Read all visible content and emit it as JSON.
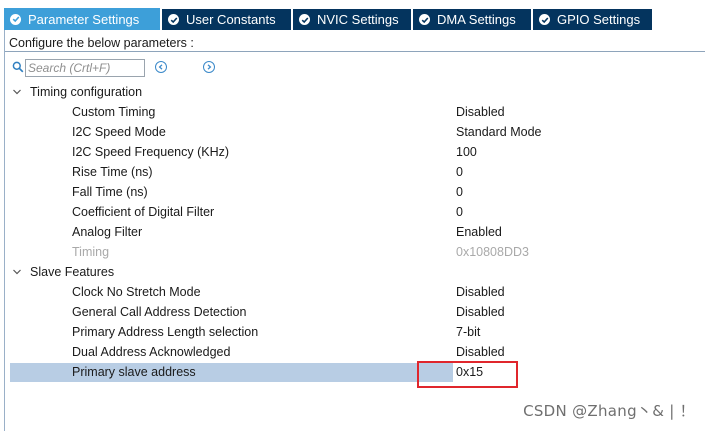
{
  "tabs": [
    {
      "label": "Parameter Settings",
      "active": true,
      "icon": "check-circle-icon"
    },
    {
      "label": "User Constants",
      "active": false,
      "icon": "check-circle-icon"
    },
    {
      "label": "NVIC Settings",
      "active": false,
      "icon": "check-circle-icon"
    },
    {
      "label": "DMA Settings",
      "active": false,
      "icon": "check-circle-icon"
    },
    {
      "label": "GPIO Settings",
      "active": false,
      "icon": "check-circle-icon"
    }
  ],
  "configure_label": "Configure the below parameters :",
  "search": {
    "placeholder": "Search (Crtl+F)",
    "value": ""
  },
  "groups": [
    {
      "title": "Timing configuration",
      "expanded": true,
      "params": [
        {
          "label": "Custom Timing",
          "value": "Disabled"
        },
        {
          "label": "I2C Speed Mode",
          "value": "Standard Mode"
        },
        {
          "label": "I2C Speed Frequency (KHz)",
          "value": "100"
        },
        {
          "label": "Rise Time (ns)",
          "value": "0"
        },
        {
          "label": "Fall Time (ns)",
          "value": "0"
        },
        {
          "label": "Coefficient of Digital Filter",
          "value": "0"
        },
        {
          "label": "Analog Filter",
          "value": "Enabled"
        },
        {
          "label": "Timing",
          "value": "0x10808DD3",
          "disabled": true
        }
      ]
    },
    {
      "title": "Slave Features",
      "expanded": true,
      "params": [
        {
          "label": "Clock No Stretch Mode",
          "value": "Disabled"
        },
        {
          "label": "General Call Address Detection",
          "value": "Disabled"
        },
        {
          "label": "Primary Address Length selection",
          "value": "7-bit"
        },
        {
          "label": "Dual Address Acknowledged",
          "value": "Disabled"
        },
        {
          "label": "Primary slave address",
          "value": "0x15",
          "selected": true
        }
      ]
    }
  ],
  "watermark": "CSDN @Zhang丶& | ！",
  "colors": {
    "tab_active": "#3d9fd9",
    "tab_inactive": "#04345e",
    "selection": "#b8cde4",
    "highlight_border": "#e0262c",
    "disabled_text": "#a9a9a9"
  }
}
